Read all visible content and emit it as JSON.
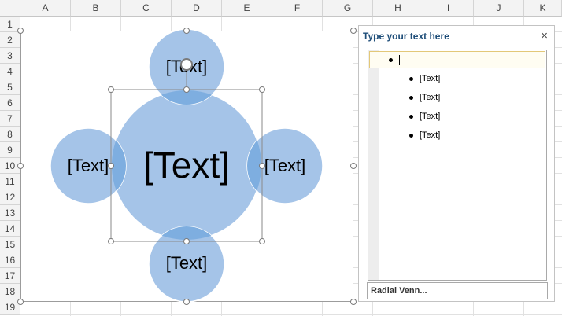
{
  "sheet": {
    "columns": [
      "A",
      "B",
      "C",
      "D",
      "E",
      "F",
      "G",
      "H",
      "I",
      "J",
      "K"
    ],
    "rows": [
      "1",
      "2",
      "3",
      "4",
      "5",
      "6",
      "7",
      "8",
      "9",
      "10",
      "11",
      "12",
      "13",
      "14",
      "15",
      "16",
      "17",
      "18",
      "19"
    ]
  },
  "smartart": {
    "center_label": "[Text]",
    "top_label": "[Text]",
    "left_label": "[Text]",
    "right_label": "[Text]",
    "bottom_label": "[Text]",
    "circle_color": "#a5c4e8",
    "overlap_color": "#7eaee0"
  },
  "text_pane": {
    "title": "Type your text here",
    "close_glyph": "×",
    "child_items": [
      "[Text]",
      "[Text]",
      "[Text]",
      "[Text]"
    ],
    "layout_name": "Radial Venn..."
  }
}
